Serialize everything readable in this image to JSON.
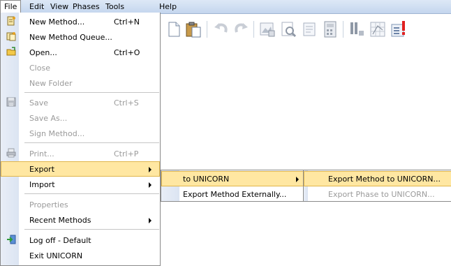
{
  "menubar": {
    "items": [
      "File",
      "Edit",
      "View",
      "Phases",
      "Tools",
      "Help"
    ]
  },
  "file_menu": {
    "items": [
      {
        "label": "New Method...",
        "shortcut": "Ctrl+N",
        "icon": "new-method-icon"
      },
      {
        "label": "New Method Queue...",
        "shortcut": "",
        "icon": "new-queue-icon"
      },
      {
        "label": "Open...",
        "shortcut": "Ctrl+O",
        "icon": "open-folder-icon"
      },
      {
        "label": "Close",
        "shortcut": "",
        "disabled": true
      },
      {
        "label": "New Folder",
        "shortcut": "",
        "disabled": true
      },
      {
        "label": "Save",
        "shortcut": "Ctrl+S",
        "disabled": true,
        "icon": "save-icon"
      },
      {
        "label": "Save As...",
        "shortcut": "",
        "disabled": true
      },
      {
        "label": "Sign Method...",
        "shortcut": "",
        "disabled": true
      },
      {
        "label": "Print...",
        "shortcut": "Ctrl+P",
        "disabled": true,
        "icon": "print-icon"
      },
      {
        "label": "Export",
        "shortcut": "",
        "submenu": true
      },
      {
        "label": "Import",
        "shortcut": "",
        "submenu": true
      },
      {
        "label": "Properties",
        "shortcut": "",
        "disabled": true
      },
      {
        "label": "Recent Methods",
        "shortcut": "",
        "submenu": true
      },
      {
        "label": "Log off - Default",
        "shortcut": "",
        "icon": "log-off-icon"
      },
      {
        "label": "Exit UNICORN",
        "shortcut": ""
      }
    ]
  },
  "export_menu": {
    "items": [
      {
        "label": "to UNICORN",
        "submenu": true
      },
      {
        "label": "Export Method Externally..."
      }
    ]
  },
  "unicorn_menu": {
    "items": [
      {
        "label": "Export Method to UNICORN..."
      },
      {
        "label": "Export Phase to UNICORN...",
        "disabled": true
      }
    ]
  },
  "colors": {
    "highlight": "#ffe7a2",
    "highlight_border": "#e0b54a",
    "menubar": "#c4d6ee",
    "gutter": "#dbe4f2"
  },
  "toolbar_icons": [
    "new-document-icon",
    "paste-icon",
    "undo-icon",
    "redo-icon",
    "image-icon",
    "print-preview-icon",
    "notes-icon",
    "calculator-icon",
    "column-icon",
    "grid-icon",
    "alert-list-icon"
  ]
}
